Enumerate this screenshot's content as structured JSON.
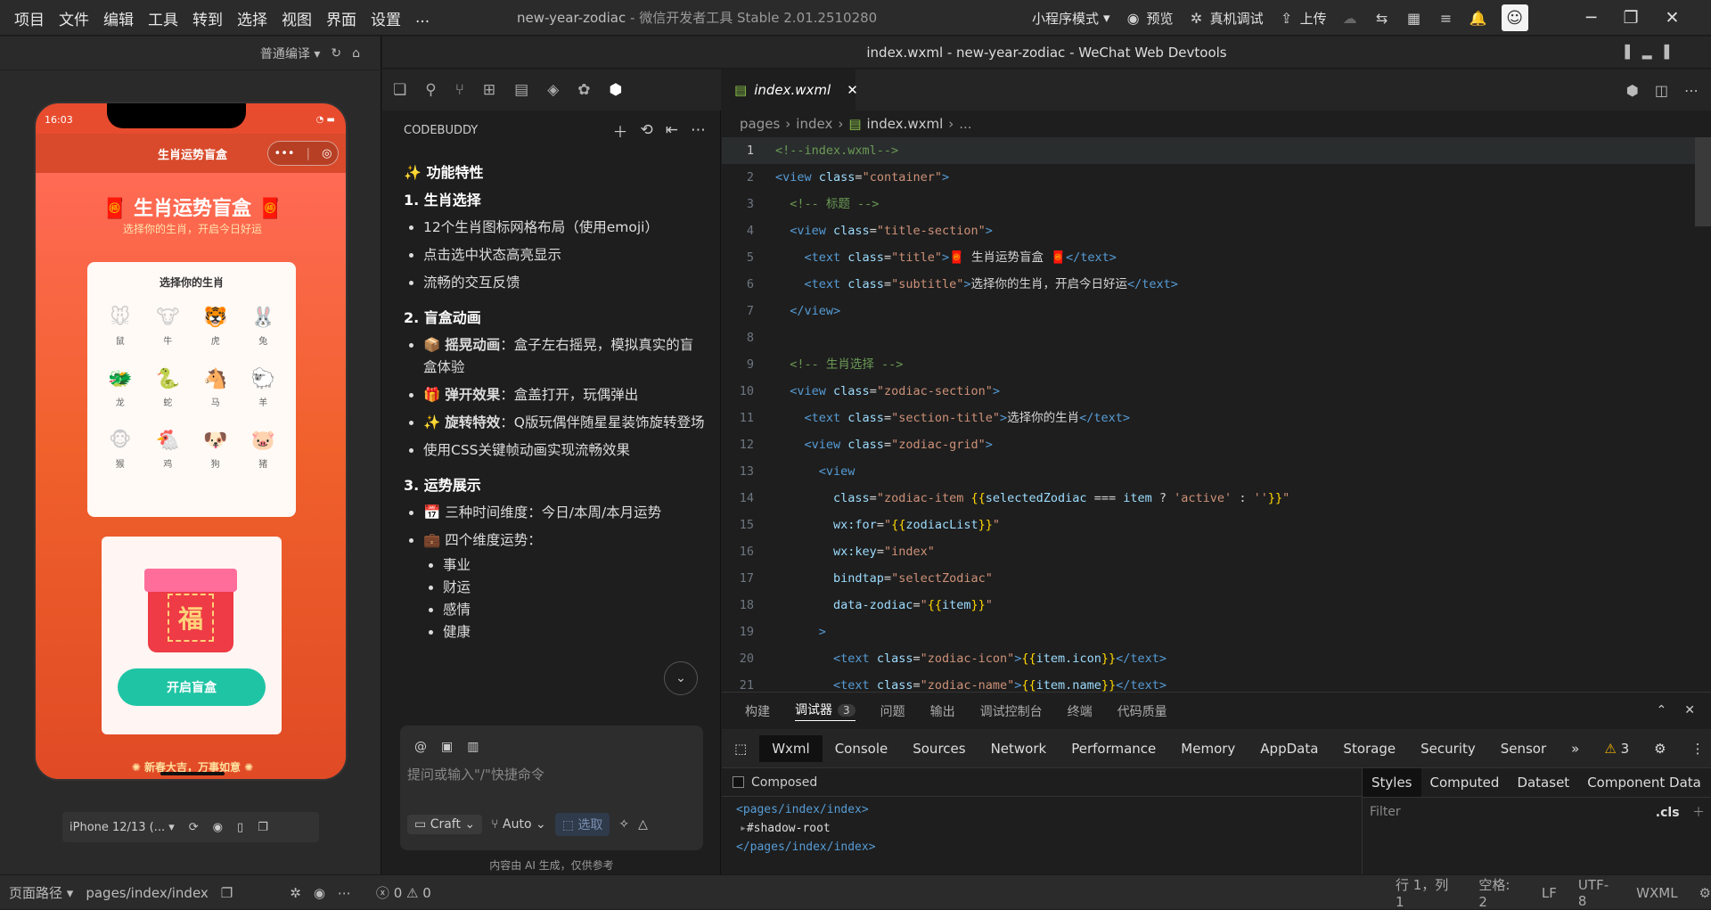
{
  "menubar": {
    "items": [
      "项目",
      "文件",
      "编辑",
      "工具",
      "转到",
      "选择",
      "视图",
      "界面",
      "设置",
      "..."
    ],
    "project_name": "new-year-zodiac",
    "app_title": "微信开发者工具 Stable 2.01.2510280",
    "mode": "小程序模式",
    "preview": "预览",
    "debug": "真机调试",
    "upload": "上传"
  },
  "simulator": {
    "compile_mode": "普通编译",
    "time": "16:03",
    "nav_title": "生肖运势盲盒",
    "page_title": "🧧 生肖运势盲盒 🧧",
    "page_subtitle": "选择你的生肖，开启今日好运",
    "card_title": "选择你的生肖",
    "zodiacs": [
      {
        "icon": "🐭",
        "name": "鼠"
      },
      {
        "icon": "🐮",
        "name": "牛"
      },
      {
        "icon": "🐯",
        "name": "虎"
      },
      {
        "icon": "🐰",
        "name": "兔"
      },
      {
        "icon": "🐲",
        "name": "龙"
      },
      {
        "icon": "🐍",
        "name": "蛇"
      },
      {
        "icon": "🐴",
        "name": "马"
      },
      {
        "icon": "🐑",
        "name": "羊"
      },
      {
        "icon": "🐵",
        "name": "猴"
      },
      {
        "icon": "🐔",
        "name": "鸡"
      },
      {
        "icon": "🐶",
        "name": "狗"
      },
      {
        "icon": "🐷",
        "name": "猪"
      }
    ],
    "box_char": "福",
    "open_button": "开启盲盒",
    "footer": "新春大吉，万事如意",
    "device": "iPhone 12/13 (..."
  },
  "statusbar": {
    "page_path_label": "页面路径",
    "page_path": "pages/index/index",
    "errors": "0",
    "warnings": "0",
    "cursor": "行 1，列 1",
    "spaces": "空格: 2",
    "eol": "LF",
    "encoding": "UTF-8",
    "language": "WXML"
  },
  "ide": {
    "title": "index.wxml - new-year-zodiac - WeChat Web Devtools"
  },
  "codebuddy": {
    "header": "CODEBUDDY",
    "feature_heading": "✨ 功能特性",
    "s1_title": "1. 生肖选择",
    "s1_items": [
      "12个生肖图标网格布局（使用emoji）",
      "点击选中状态高亮显示",
      "流畅的交互反馈"
    ],
    "s2_title": "2. 盲盒动画",
    "s2_items": [
      {
        "icon": "📦",
        "bold": "摇晃动画",
        "text": "：盒子左右摇晃，模拟真实的盲盒体验"
      },
      {
        "icon": "🎁",
        "bold": "弹开效果",
        "text": "：盒盖打开，玩偶弹出"
      },
      {
        "icon": "✨",
        "bold": "旋转特效",
        "text": "：Q版玩偶伴随星星装饰旋转登场"
      }
    ],
    "s2_last": "使用CSS关键帧动画实现流畅效果",
    "s3_title": "3. 运势展示",
    "s3_item1": "📅 三种时间维度：今日/本周/本月运势",
    "s3_item2": "💼 四个维度运势：",
    "s3_sub": [
      "事业",
      "财运",
      "感情",
      "健康"
    ],
    "input_placeholder": "提问或输入\"/\"快捷命令",
    "mode_craft": "Craft",
    "mode_auto": "Auto",
    "select_label": "选取",
    "note": "内容由 AI 生成，仅供参考"
  },
  "editor": {
    "tab": "index.wxml",
    "breadcrumb": [
      "pages",
      "index",
      "index.wxml",
      "..."
    ]
  },
  "devtools": {
    "tabs": [
      "构建",
      "调试器",
      "问题",
      "输出",
      "调试控制台",
      "终端",
      "代码质量"
    ],
    "debugger_badge": "3",
    "subtabs": [
      "Wxml",
      "Console",
      "Sources",
      "Network",
      "Performance",
      "Memory",
      "AppData",
      "Storage",
      "Security",
      "Sensor"
    ],
    "warn_count": "3",
    "composed": "Composed",
    "tree": [
      "<pages/index/index>",
      "#shadow-root",
      "</pages/index/index>"
    ],
    "style_tabs": [
      "Styles",
      "Computed",
      "Dataset",
      "Component Data"
    ],
    "filter": "Filter",
    "cls": ".cls"
  }
}
